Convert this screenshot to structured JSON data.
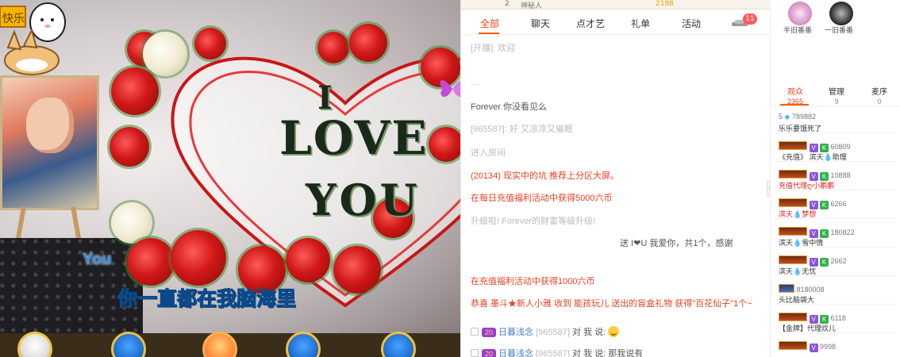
{
  "chat": {
    "topstrip": {
      "count": "2",
      "username": "神秘人",
      "coins": "2188"
    },
    "tabs": [
      {
        "label": "全部"
      },
      {
        "label": "聊天"
      },
      {
        "label": "点才艺"
      },
      {
        "label": "礼单"
      },
      {
        "label": "活动"
      }
    ],
    "badge_count": "11",
    "messages": {
      "m1": "[开播]: 欢迎",
      "m2": "Forever 你没看见么",
      "m3": "[965587]: 好 又凉凉又催眠",
      "m4": "进入房间",
      "m5": "(20134) 现实中的坑 推荐上分区大屏。",
      "m6": "在每日充值福利活动中获得5000六币",
      "m7": "升级啦! Forever的财富等级升级!",
      "m8": "送 I❤U 我爱你，共1个，感谢",
      "m9": "在充值福利活动中获得1000六币",
      "m10": "恭喜 墨斗★新人小雅 收到 能孩玩儿 送出的盲盒礼物 获得\"百花仙子\"1个~",
      "m11_name": "日暮浅念",
      "m11_id": "[965587]",
      "m11_text": "对 我 说:",
      "m12_name": "日暮浅念",
      "m12_id": "[965587]",
      "m12_text": "对 我 说:  那我说有"
    },
    "level_badge": "20"
  },
  "video": {
    "love_i": "I",
    "love_love": "LOVE",
    "love_you": "YOU",
    "you_label": "You",
    "subtitle": "你一直都在我脑海里",
    "sticker": "快乐"
  },
  "audience": {
    "top_ranks": [
      {
        "name": "半旧番番"
      },
      {
        "name": "一旧番番"
      }
    ],
    "tabs": [
      {
        "label": "观众",
        "count": "2365"
      },
      {
        "label": "管理",
        "count": "9"
      },
      {
        "label": "麦序",
        "count": "0"
      }
    ],
    "users": [
      {
        "id": "789882",
        "name": "乐乐要饿死了",
        "prefix": "5"
      },
      {
        "id": "60809",
        "name": "《充值》 滨天💧助理"
      },
      {
        "id": "10888",
        "name": "充值代理ღ小鹏鹏",
        "name_red": true
      },
      {
        "id": "6266",
        "name": "滨天💧梦想",
        "name_red": true
      },
      {
        "id": "180822",
        "name": "滨天💧雪中情"
      },
      {
        "id": "2662",
        "name": "滨天💧无忧"
      },
      {
        "id": "8180008",
        "name": "头比脑袋大"
      },
      {
        "id": "6118",
        "name": "【金牌】代理炊儿"
      },
      {
        "id": "9998",
        "name": ""
      }
    ]
  },
  "colors": {
    "accent": "#ff5a00",
    "chat_system": "#e8411f",
    "subtitle": "#35b6ff"
  }
}
